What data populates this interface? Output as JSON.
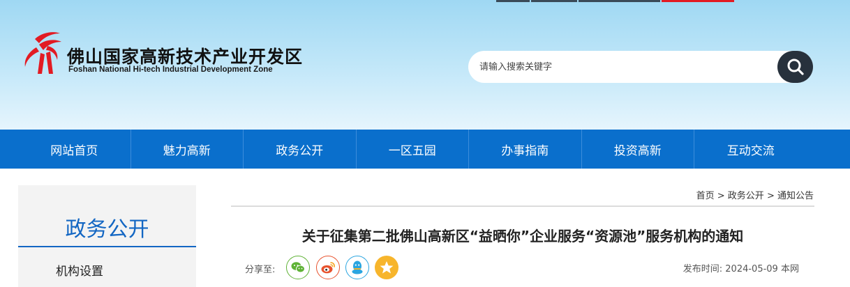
{
  "site": {
    "name_cn": "佛山国家高新技术产业开发区",
    "name_en": "Foshan National Hi-tech Industrial Development Zone",
    "brand_red": "#e21b23",
    "header_bg": "#b4e2f7",
    "top_strip_colors": [
      "#3a4a58",
      "#3a4a58",
      "#3a4a58",
      "#e21b23"
    ]
  },
  "search": {
    "placeholder": "请输入搜索关键字",
    "button_icon": "search-icon"
  },
  "nav": {
    "color": "#0a6fcc",
    "items": [
      {
        "label": "网站首页"
      },
      {
        "label": "魅力高新"
      },
      {
        "label": "政务公开"
      },
      {
        "label": "一区五园"
      },
      {
        "label": "办事指南"
      },
      {
        "label": "投资高新"
      },
      {
        "label": "互动交流"
      }
    ]
  },
  "sidebar": {
    "title": "政务公开",
    "items": [
      {
        "label": "机构设置"
      }
    ]
  },
  "breadcrumb": {
    "home": "首页",
    "sep": ">",
    "level1": "政务公开",
    "level2": "通知公告"
  },
  "article": {
    "title": "关于征集第二批佛山高新区“益晒你”企业服务“资源池”服务机构的通知",
    "share_label": "分享至:",
    "share_targets": [
      {
        "icon": "wechat-icon",
        "color": "#5fb236"
      },
      {
        "icon": "weibo-icon",
        "color": "#e8542f"
      },
      {
        "icon": "qq-icon",
        "color": "#2aa5e0"
      },
      {
        "icon": "qzone-star-icon",
        "color": "#f7b52c"
      }
    ],
    "publish_label": "发布时间:",
    "publish_date": "2024-05-09",
    "source": "本网"
  }
}
